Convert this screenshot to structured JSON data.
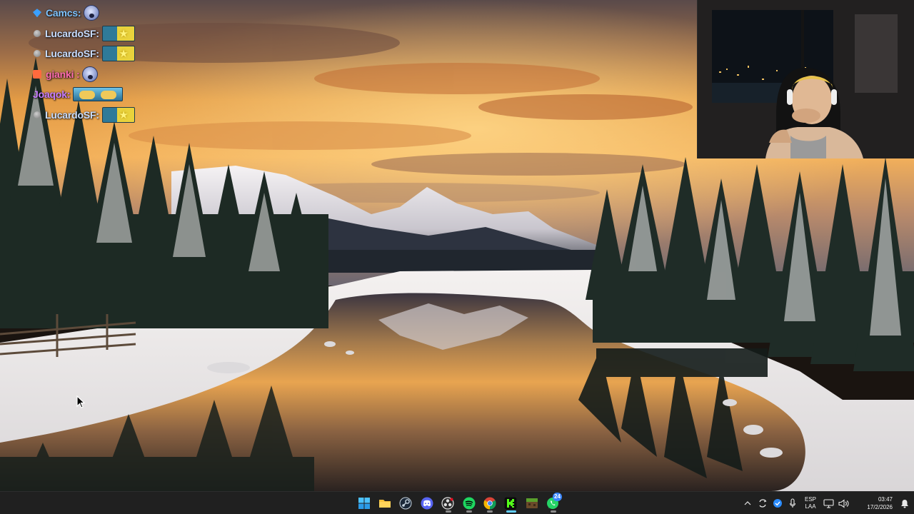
{
  "chat": {
    "messages": [
      {
        "user": "Camcs:",
        "color": "#7fc4ff",
        "badge": "gem",
        "emote": "face-emote"
      },
      {
        "user": "LucardoSF:",
        "color": "#c8ddff",
        "badge": "dot",
        "emote": "box-emote"
      },
      {
        "user": "LucardoSF:",
        "color": "#c8ddff",
        "badge": "dot",
        "emote": "box-emote"
      },
      {
        "user": "gianki :",
        "color": "#ff6cb0",
        "badge": "sub",
        "emote": "face-emote"
      },
      {
        "user": "Joaqok:",
        "color": "#c77dff",
        "badge": "none",
        "emote": "wide-emote"
      },
      {
        "user": "LucardoSF:",
        "color": "#c8ddff",
        "badge": "dot",
        "emote": "box-emote"
      }
    ]
  },
  "taskbar": {
    "apps": [
      {
        "name": "start-button",
        "icon": "windows-logo-icon",
        "active": false
      },
      {
        "name": "file-explorer",
        "icon": "folder-icon",
        "active": false
      },
      {
        "name": "steam",
        "icon": "steam-icon",
        "active": false
      },
      {
        "name": "discord",
        "icon": "discord-icon",
        "active": false
      },
      {
        "name": "obs",
        "icon": "obs-icon",
        "active": true
      },
      {
        "name": "spotify",
        "icon": "spotify-icon",
        "active": true
      },
      {
        "name": "chrome",
        "icon": "chrome-icon",
        "active": true
      },
      {
        "name": "kick",
        "icon": "kick-icon",
        "active": true
      },
      {
        "name": "minecraft",
        "icon": "game-block-icon",
        "active": false
      },
      {
        "name": "whatsapp",
        "icon": "whatsapp-icon",
        "active": true,
        "badge": "24"
      }
    ],
    "tray": {
      "language_top": "ESP",
      "language_bottom": "LAA",
      "time": "03:47",
      "date": "17/2/2026"
    }
  },
  "colors": {
    "taskbar_bg": "#202020",
    "accent": "#60cdff"
  }
}
